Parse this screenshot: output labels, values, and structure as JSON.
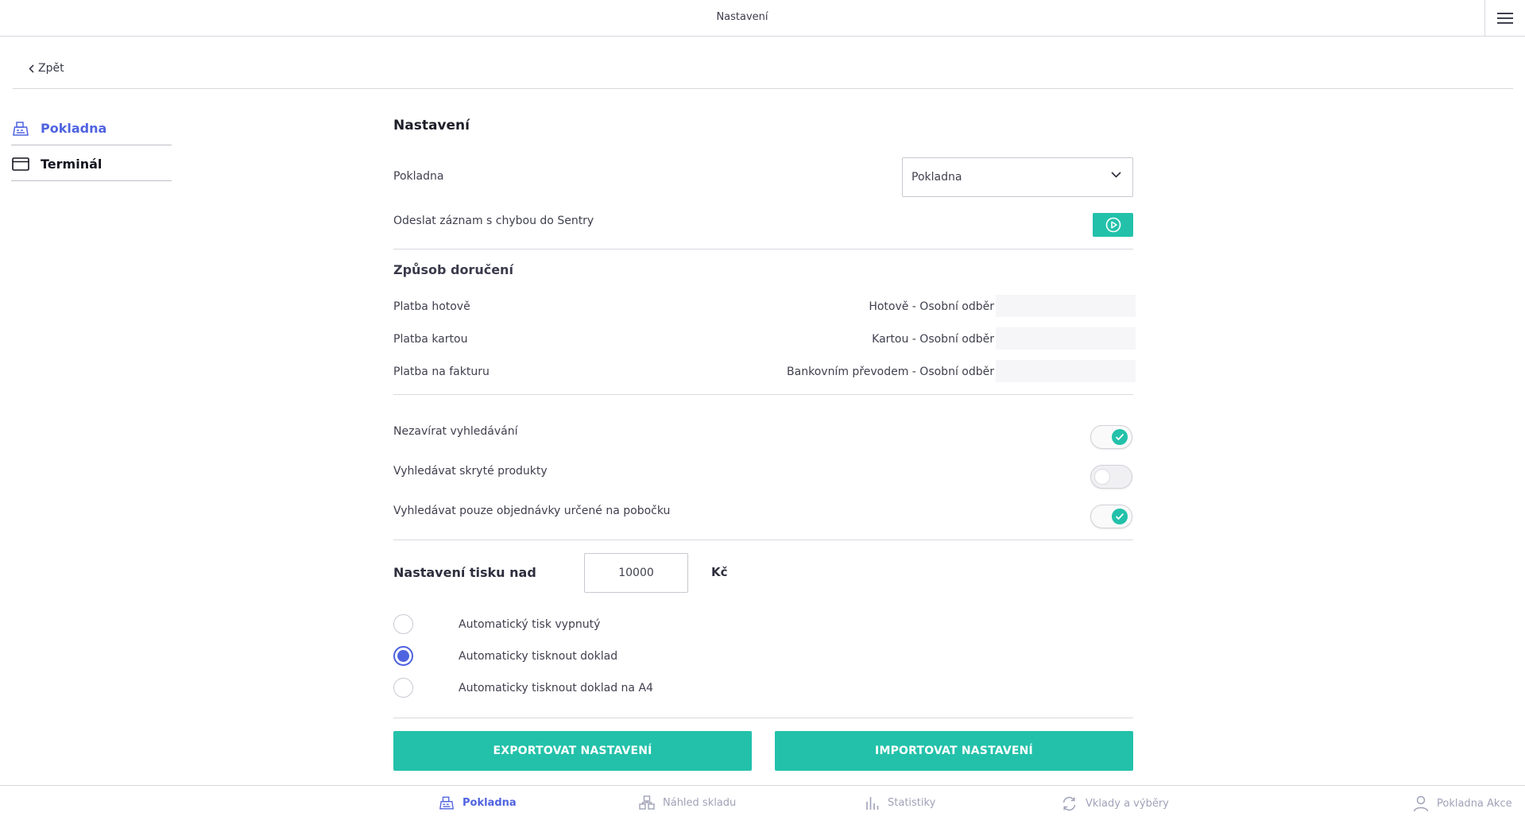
{
  "topbar": {
    "title": "Nastavení"
  },
  "back": {
    "label": "Zpět"
  },
  "sidebar": {
    "items": [
      {
        "label": "Pokladna",
        "icon": "cash-register-icon",
        "active": true
      },
      {
        "label": "Terminál",
        "icon": "card-icon",
        "active": false
      }
    ]
  },
  "settings": {
    "title": "Nastavení",
    "register_label": "Pokladna",
    "register_value": "Pokladna",
    "sentry_label": "Odeslat záznam s chybou do Sentry",
    "delivery": {
      "title": "Způsob doručení",
      "rows": [
        {
          "label": "Platba hotově",
          "value": "Hotově - Osobní odběr"
        },
        {
          "label": "Platba kartou",
          "value": "Kartou - Osobní odběr"
        },
        {
          "label": "Platba na fakturu",
          "value": "Bankovním převodem - Osobní odběr"
        }
      ]
    },
    "toggles": [
      {
        "label": "Nezavírat vyhledávání",
        "on": true
      },
      {
        "label": "Vyhledávat skryté produkty",
        "on": false
      },
      {
        "label": "Vyhledávat pouze objednávky určené na pobočku",
        "on": true
      }
    ],
    "print": {
      "label": "Nastavení tisku nad",
      "value": "10000",
      "unit": "Kč",
      "options": [
        {
          "label": "Automatický tisk vypnutý",
          "checked": false
        },
        {
          "label": "Automaticky tisknout doklad",
          "checked": true
        },
        {
          "label": "Automaticky tisknout doklad na A4",
          "checked": false
        }
      ]
    },
    "export_label": "EXPORTOVAT NASTAVENÍ",
    "import_label": "IMPORTOVAT NASTAVENÍ"
  },
  "bottom_nav": {
    "items": [
      {
        "label": "Pokladna",
        "icon": "cash-register-icon",
        "active": true
      },
      {
        "label": "Náhled skladu",
        "icon": "warehouse-icon",
        "active": false
      },
      {
        "label": "Statistiky",
        "icon": "bar-chart-icon",
        "active": false
      },
      {
        "label": "Vklady a výběry",
        "icon": "refresh-icon",
        "active": false
      },
      {
        "label": "Pokladna Akce",
        "icon": "user-icon",
        "active": false
      }
    ]
  },
  "colors": {
    "accent": "#23c1aa",
    "primary": "#4f63e0",
    "muted": "#a0a2b8"
  }
}
